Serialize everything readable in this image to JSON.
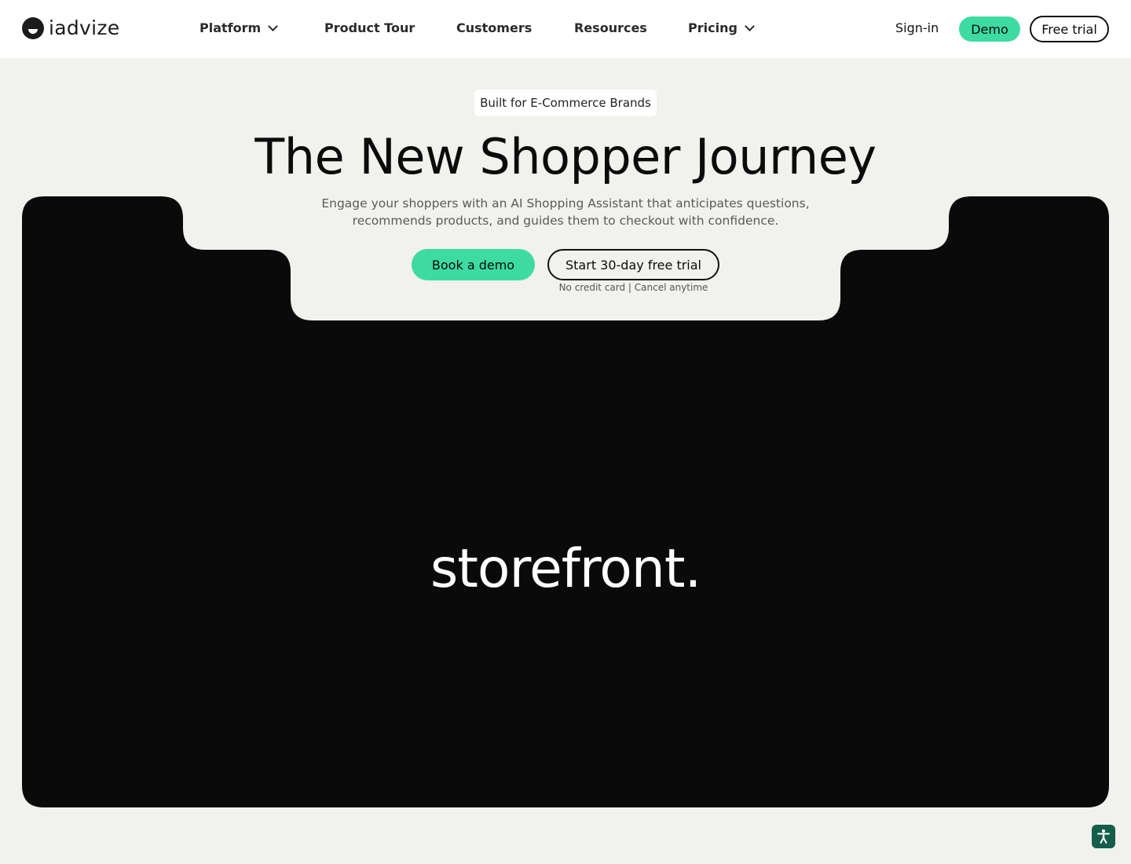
{
  "brand": {
    "name": "iadvize"
  },
  "nav": {
    "links": [
      {
        "label": "Platform",
        "has_dropdown": true
      },
      {
        "label": "Product Tour",
        "has_dropdown": false
      },
      {
        "label": "Customers",
        "has_dropdown": false
      },
      {
        "label": "Resources",
        "has_dropdown": false
      },
      {
        "label": "Pricing",
        "has_dropdown": true
      }
    ],
    "signin_label": "Sign-in",
    "demo_label": "Demo",
    "free_trial_label": "Free trial"
  },
  "hero": {
    "badge": "Built for E-Commerce Brands",
    "title": "The New Shopper Journey",
    "subtitle_line1": "Engage your shoppers with an AI Shopping Assistant that anticipates questions,",
    "subtitle_line2": "recommends products, and guides them to checkout with confidence.",
    "book_demo_label": "Book a demo",
    "start_trial_label": "Start 30-day free trial",
    "trial_note": "No credit card | Cancel anytime"
  },
  "media": {
    "caption": "storefront."
  },
  "accessibility": {
    "icon": "accessibility-icon"
  },
  "colors": {
    "accent": "#3ddba3",
    "background": "#f1f1ee",
    "panel": "#0a0a0a",
    "accessibility_button": "#155e4c"
  }
}
